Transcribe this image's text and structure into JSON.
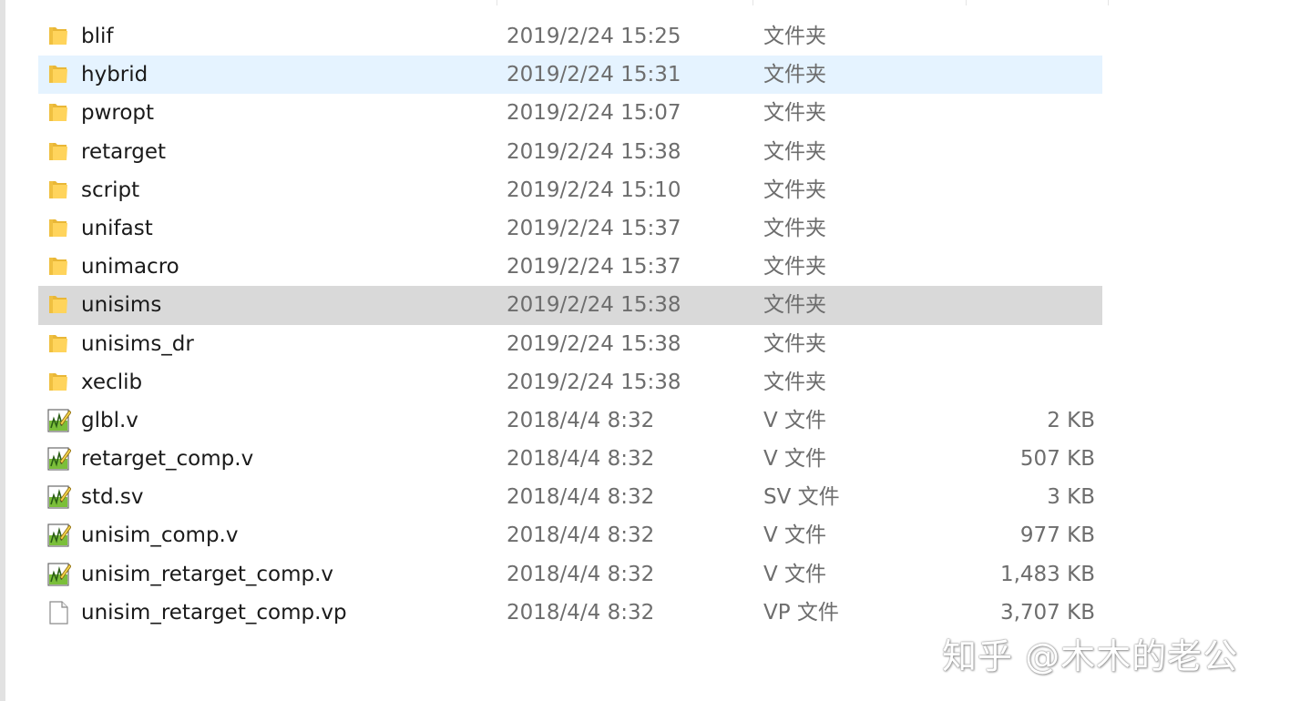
{
  "files": [
    {
      "name": "blif",
      "modified": "2019/2/24 15:25",
      "type": "文件夹",
      "size": "",
      "icon": "folder-icon",
      "state": "normal"
    },
    {
      "name": "hybrid",
      "modified": "2019/2/24 15:31",
      "type": "文件夹",
      "size": "",
      "icon": "folder-icon",
      "state": "hover"
    },
    {
      "name": "pwropt",
      "modified": "2019/2/24 15:07",
      "type": "文件夹",
      "size": "",
      "icon": "folder-icon",
      "state": "normal"
    },
    {
      "name": "retarget",
      "modified": "2019/2/24 15:38",
      "type": "文件夹",
      "size": "",
      "icon": "folder-icon",
      "state": "normal"
    },
    {
      "name": "script",
      "modified": "2019/2/24 15:10",
      "type": "文件夹",
      "size": "",
      "icon": "folder-icon",
      "state": "normal"
    },
    {
      "name": "unifast",
      "modified": "2019/2/24 15:37",
      "type": "文件夹",
      "size": "",
      "icon": "folder-icon",
      "state": "normal"
    },
    {
      "name": "unimacro",
      "modified": "2019/2/24 15:37",
      "type": "文件夹",
      "size": "",
      "icon": "folder-icon",
      "state": "normal"
    },
    {
      "name": "unisims",
      "modified": "2019/2/24 15:38",
      "type": "文件夹",
      "size": "",
      "icon": "folder-icon",
      "state": "selected"
    },
    {
      "name": "unisims_dr",
      "modified": "2019/2/24 15:38",
      "type": "文件夹",
      "size": "",
      "icon": "folder-icon",
      "state": "normal"
    },
    {
      "name": "xeclib",
      "modified": "2019/2/24 15:38",
      "type": "文件夹",
      "size": "",
      "icon": "folder-icon",
      "state": "normal"
    },
    {
      "name": "glbl.v",
      "modified": "2018/4/4 8:32",
      "type": "V 文件",
      "size": "2 KB",
      "icon": "verilog-file-icon",
      "state": "normal"
    },
    {
      "name": "retarget_comp.v",
      "modified": "2018/4/4 8:32",
      "type": "V 文件",
      "size": "507 KB",
      "icon": "verilog-file-icon",
      "state": "normal"
    },
    {
      "name": "std.sv",
      "modified": "2018/4/4 8:32",
      "type": "SV 文件",
      "size": "3 KB",
      "icon": "verilog-file-icon",
      "state": "normal"
    },
    {
      "name": "unisim_comp.v",
      "modified": "2018/4/4 8:32",
      "type": "V 文件",
      "size": "977 KB",
      "icon": "verilog-file-icon",
      "state": "normal"
    },
    {
      "name": "unisim_retarget_comp.v",
      "modified": "2018/4/4 8:32",
      "type": "V 文件",
      "size": "1,483 KB",
      "icon": "verilog-file-icon",
      "state": "normal"
    },
    {
      "name": "unisim_retarget_comp.vp",
      "modified": "2018/4/4 8:32",
      "type": "VP 文件",
      "size": "3,707 KB",
      "icon": "blank-file-icon",
      "state": "normal"
    }
  ],
  "colors": {
    "hover_row": "#e5f3ff",
    "selected_row": "#d9d9d9",
    "folder": "#f5c542",
    "secondary_text": "#6d6d6d"
  },
  "watermark": "知乎 @木木的老公"
}
